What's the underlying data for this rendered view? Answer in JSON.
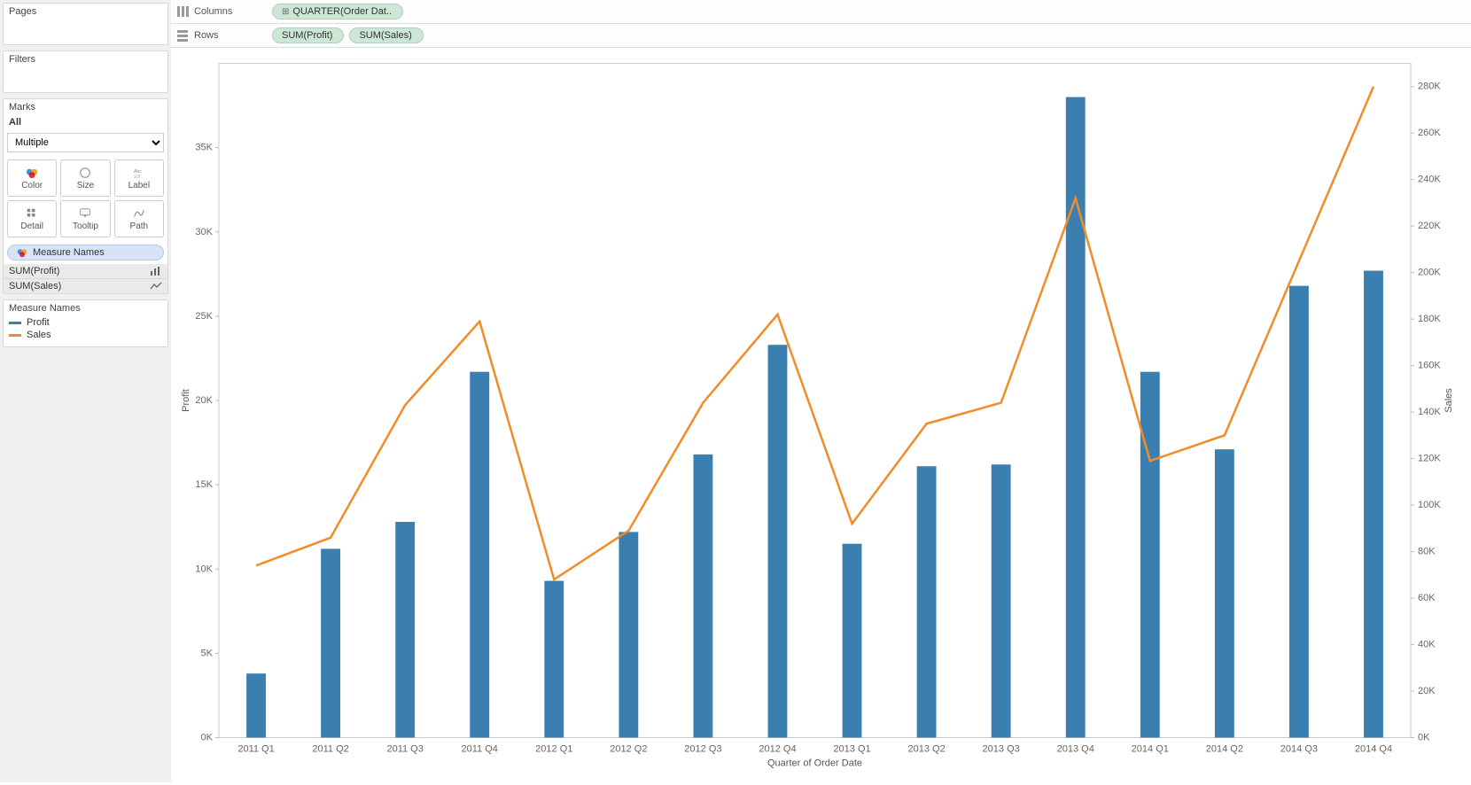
{
  "sidebar": {
    "pages": {
      "title": "Pages"
    },
    "filters": {
      "title": "Filters"
    },
    "marks": {
      "title": "Marks",
      "all": "All",
      "select_value": "Multiple",
      "buttons": [
        {
          "name": "color",
          "label": "Color"
        },
        {
          "name": "size",
          "label": "Size"
        },
        {
          "name": "label",
          "label": "Label"
        },
        {
          "name": "detail",
          "label": "Detail"
        },
        {
          "name": "tooltip",
          "label": "Tooltip"
        },
        {
          "name": "path",
          "label": "Path"
        }
      ],
      "measure_names_pill": "Measure Names",
      "measures": [
        {
          "label": "SUM(Profit)",
          "type": "bar"
        },
        {
          "label": "SUM(Sales)",
          "type": "line"
        }
      ]
    },
    "legend": {
      "title": "Measure Names",
      "items": [
        {
          "label": "Profit",
          "color": "#3a7fb0"
        },
        {
          "label": "Sales",
          "color": "#f28c28"
        }
      ]
    }
  },
  "shelves": {
    "columns": {
      "label": "Columns",
      "pills": [
        "QUARTER(Order Dat.."
      ]
    },
    "rows": {
      "label": "Rows",
      "pills": [
        "SUM(Profit)",
        "SUM(Sales)"
      ]
    }
  },
  "chart_data": {
    "type": "bar",
    "title": "",
    "xlabel": "Quarter of Order Date",
    "ylabel_left": "Profit",
    "ylabel_right": "Sales",
    "categories": [
      "2011 Q1",
      "2011 Q2",
      "2011 Q3",
      "2011 Q4",
      "2012 Q1",
      "2012 Q2",
      "2012 Q3",
      "2012 Q4",
      "2013 Q1",
      "2013 Q2",
      "2013 Q3",
      "2013 Q4",
      "2014 Q1",
      "2014 Q2",
      "2014 Q3",
      "2014 Q4"
    ],
    "series": [
      {
        "name": "Profit",
        "type": "bar",
        "axis": "left",
        "color": "#3a7fb0",
        "values": [
          3800,
          11200,
          12800,
          21700,
          9300,
          12200,
          16800,
          23300,
          11500,
          16100,
          16200,
          38000,
          21700,
          17100,
          26800,
          27700
        ]
      },
      {
        "name": "Sales",
        "type": "line",
        "axis": "right",
        "color": "#f28c28",
        "values": [
          74000,
          86000,
          143000,
          179000,
          68000,
          89000,
          144000,
          182000,
          92000,
          135000,
          144000,
          232000,
          119000,
          130000,
          205000,
          280000
        ]
      }
    ],
    "ylim_left": [
      0,
      40000
    ],
    "ylim_right": [
      0,
      290000
    ],
    "yticks_left": [
      "0K",
      "5K",
      "10K",
      "15K",
      "20K",
      "25K",
      "30K",
      "35K"
    ],
    "yticks_right": [
      "0K",
      "20K",
      "40K",
      "60K",
      "80K",
      "100K",
      "120K",
      "140K",
      "160K",
      "180K",
      "200K",
      "220K",
      "240K",
      "260K",
      "280K"
    ]
  }
}
